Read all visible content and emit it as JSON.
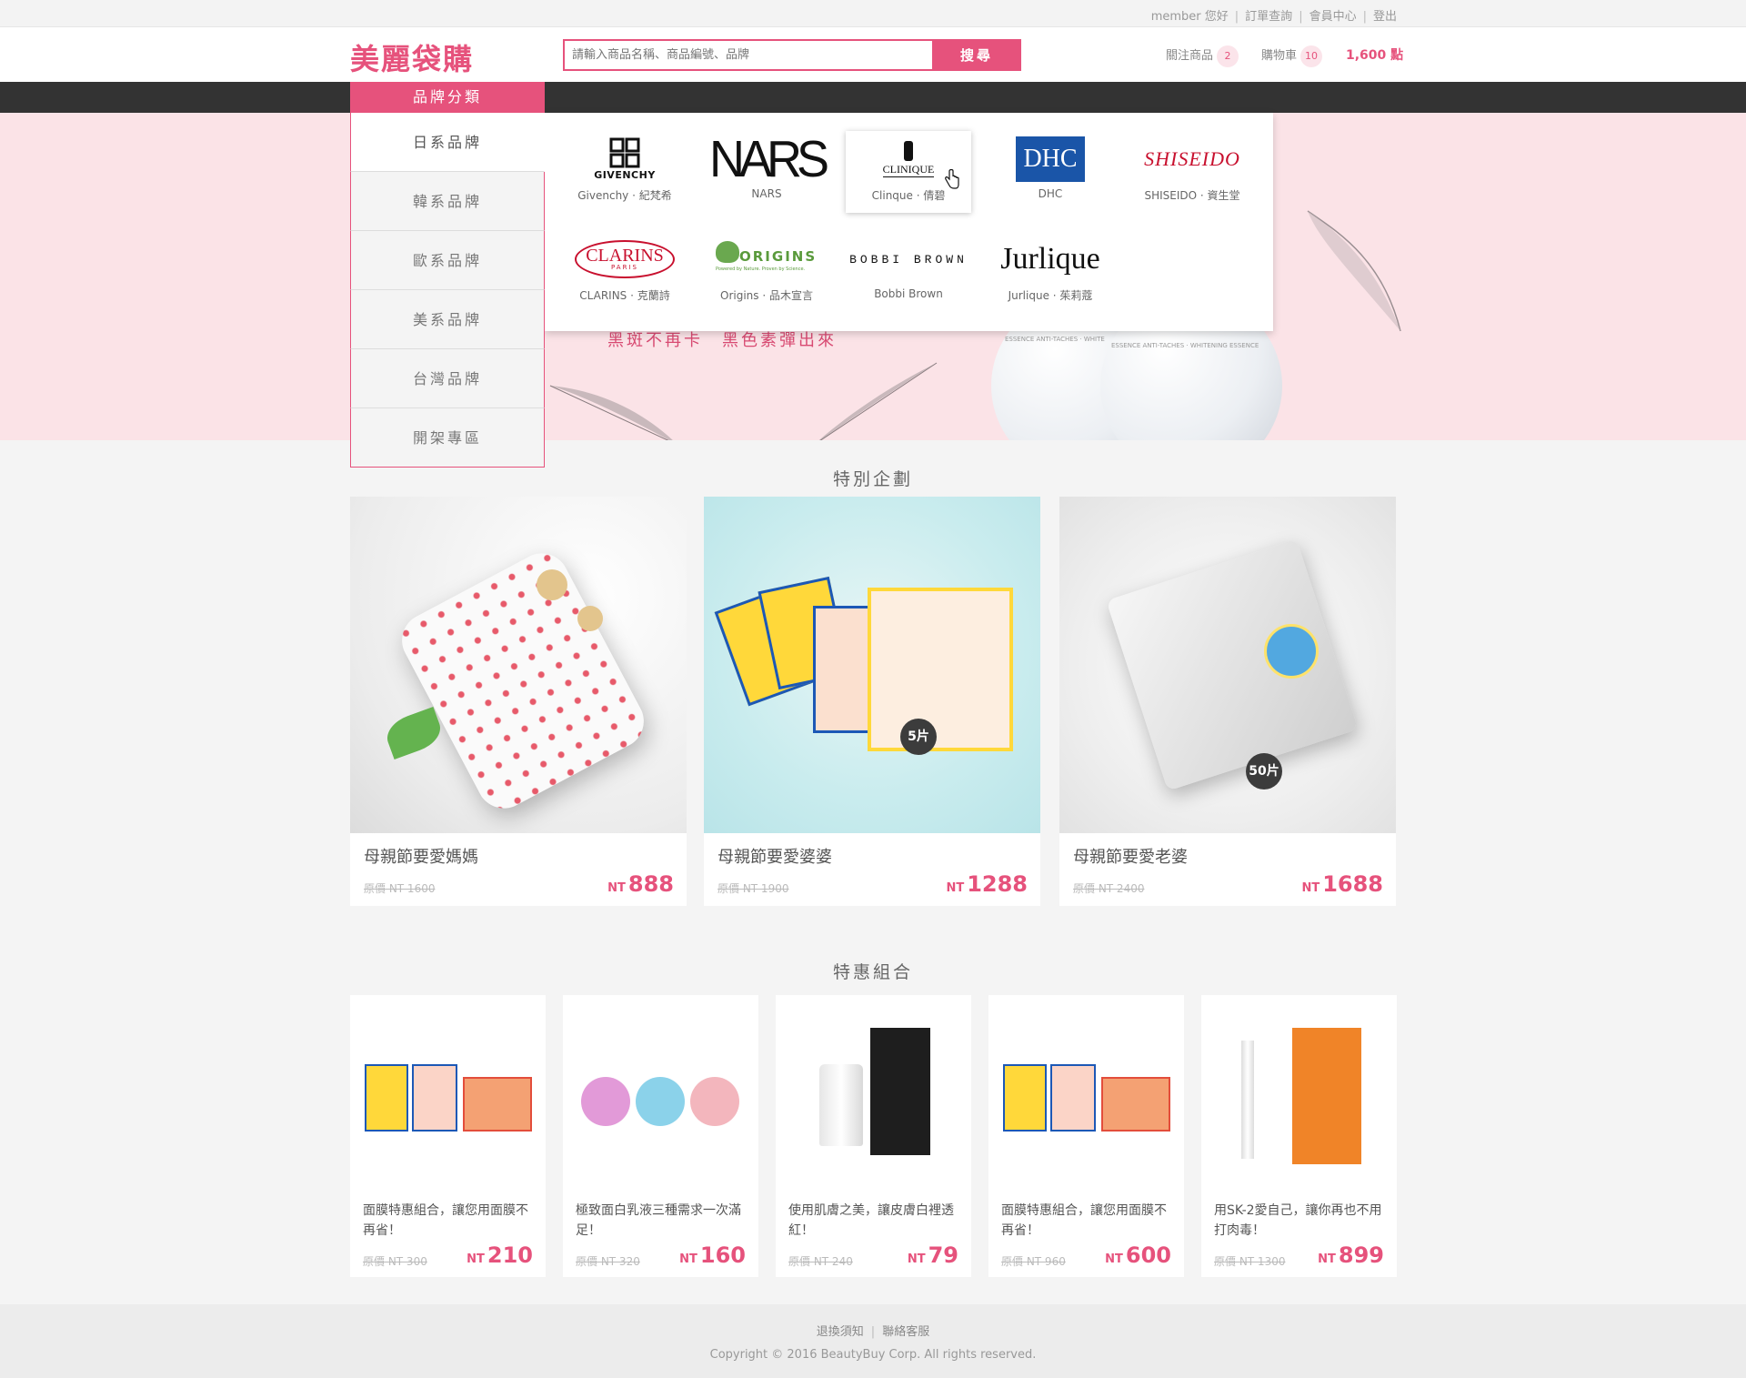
{
  "topbar": {
    "member_greeting": "member 您好",
    "orders": "訂單查詢",
    "member_center": "會員中心",
    "logout": "登出"
  },
  "header": {
    "logo": "美麗袋購",
    "search_placeholder": "請輸入商品名稱、商品編號、品牌",
    "search_button": "搜尋",
    "watch_label": "關注商品",
    "watch_count": "2",
    "cart_label": "購物車",
    "cart_count": "10",
    "points": "1,600 點"
  },
  "category_menu": {
    "title": "品牌分類",
    "items": [
      "日系品牌",
      "韓系品牌",
      "歐系品牌",
      "美系品牌",
      "台灣品牌",
      "開架專區"
    ]
  },
  "brands": [
    {
      "logo": "GIVENCHY",
      "name": "Givenchy · 紀梵希"
    },
    {
      "logo": "NARS",
      "name": "NARS"
    },
    {
      "logo": "CLINIQUE",
      "name": "Clinque · 倩碧"
    },
    {
      "logo": "DHC",
      "name": "DHC"
    },
    {
      "logo": "SHISEIDO",
      "name": "SHISEIDO · 資生堂"
    },
    {
      "logo": "CLARINS",
      "logo_sub": "PARIS",
      "name": "CLARINS · 克蘭詩"
    },
    {
      "logo": "ORIGINS",
      "logo_sub": "Powered by Nature. Proven by Science.",
      "name": "Origins · 品木宣言"
    },
    {
      "logo": "BOBBI BROWN",
      "name": "Bobbi Brown"
    },
    {
      "logo": "Jurlique",
      "name": "Jurlique · 茱莉蔻"
    }
  ],
  "banner": {
    "slogan": "黑斑不再卡　黑色素彈出來",
    "jar_text_1": "ESSENCE ANTI-TACHES · WHITE",
    "jar_text_2": "ESSENCE ANTI-TACHES · WHITENING ESSENCE"
  },
  "special": {
    "title": "特別企劃",
    "items": [
      {
        "name": "母親節要愛媽媽",
        "orig": "原價 NT 1600",
        "currency": "NT",
        "price": "888"
      },
      {
        "name": "母親節要愛婆婆",
        "orig": "原價 NT 1900",
        "currency": "NT",
        "price": "1288",
        "badge": "5片"
      },
      {
        "name": "母親節要愛老婆",
        "orig": "原價 NT 2400",
        "currency": "NT",
        "price": "1688",
        "badge": "50片"
      }
    ]
  },
  "combos": {
    "title": "特惠組合",
    "items": [
      {
        "name": "面膜特惠組合，讓您用面膜不再省！",
        "orig": "原價 NT 300",
        "currency": "NT",
        "price": "210"
      },
      {
        "name": "極致面白乳液三種需求一次滿足！",
        "orig": "原價 NT 320",
        "currency": "NT",
        "price": "160"
      },
      {
        "name": "使用肌膚之美，讓皮膚白裡透紅！",
        "orig": "原價 NT 240",
        "currency": "NT",
        "price": "79"
      },
      {
        "name": "面膜特惠組合，讓您用面膜不再省！",
        "orig": "原價 NT 960",
        "currency": "NT",
        "price": "600"
      },
      {
        "name": "用SK-2愛自己，讓你再也不用打肉毒！",
        "orig": "原價 NT 1300",
        "currency": "NT",
        "price": "899"
      }
    ]
  },
  "footer": {
    "returns": "退換須知",
    "contact": "聯絡客服",
    "copyright": "Copyright © 2016 BeautyBuy Corp. All rights reserved."
  },
  "colors": {
    "accent": "#e6527c",
    "banner_bg": "#fbe3e7",
    "dark_bar": "#333333"
  }
}
